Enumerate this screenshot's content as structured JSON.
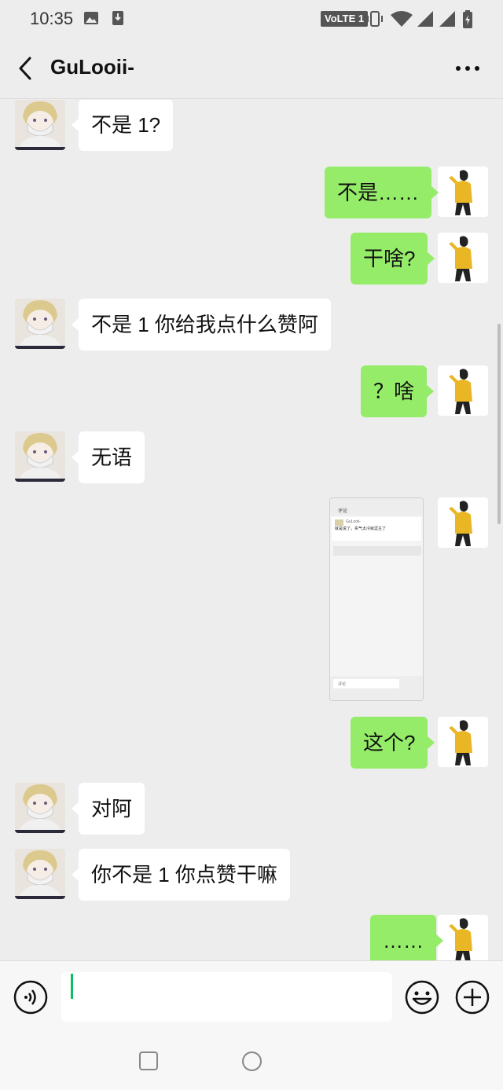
{
  "status_bar": {
    "time": "10:35",
    "network_badge": "VoLTE 1",
    "icons": [
      "image-icon",
      "download-icon",
      "vibrate-icon",
      "wifi-icon",
      "signal-icon",
      "signal-icon-2",
      "battery-icon"
    ]
  },
  "header": {
    "title": "GuLooii-",
    "back_icon": "chevron-left-icon",
    "more_icon": "more-icon"
  },
  "messages": [
    {
      "side": "left",
      "text": "不是 1?"
    },
    {
      "side": "right",
      "text": "不是……"
    },
    {
      "side": "right",
      "text": "干啥?"
    },
    {
      "side": "left",
      "text": "不是 1 你给我点什么赞阿"
    },
    {
      "side": "right",
      "text": "？啥"
    },
    {
      "side": "left",
      "text": "无语"
    },
    {
      "side": "right",
      "type": "image",
      "text": ""
    },
    {
      "side": "right",
      "text": "这个?"
    },
    {
      "side": "left",
      "text": "对阿"
    },
    {
      "side": "left",
      "text": "你不是 1 你点赞干嘛"
    },
    {
      "side": "right",
      "text": "……"
    }
  ],
  "screenshot_thumb": {
    "title": "评论",
    "name": "GuLooii-",
    "text": "就是说了，实气太冷就逗主了",
    "input_placeholder": "评论"
  },
  "input_bar": {
    "value": "",
    "voice_icon": "voice-icon",
    "emoji_icon": "emoji-icon",
    "plus_icon": "plus-icon"
  },
  "colors": {
    "background": "#ededed",
    "my_bubble": "#95ec69",
    "their_bubble": "#ffffff",
    "cursor": "#07c160"
  }
}
